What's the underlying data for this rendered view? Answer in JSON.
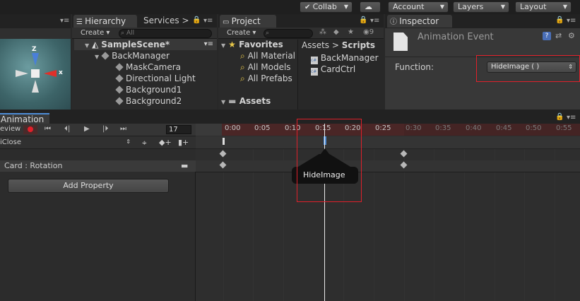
{
  "toolbar": {
    "collab": "Collab",
    "account": "Account",
    "layers": "Layers",
    "layout": "Layout"
  },
  "hierarchy": {
    "tab": "Hierarchy",
    "tab2": "Services",
    "create": "Create",
    "search_placeholder": "All",
    "scene": "SampleScene*",
    "root": "BackManager",
    "items": [
      "MaskCamera",
      "Directional Light",
      "Background1",
      "Background2"
    ]
  },
  "project": {
    "tab": "Project",
    "create": "Create",
    "count": "9",
    "favorites": "Favorites",
    "fav_items": [
      "All Material",
      "All Models",
      "All Prefabs"
    ],
    "assets": "Assets",
    "breadcrumb_root": "Assets",
    "breadcrumb_current": "Scripts",
    "files": [
      "BackManager",
      "CardCtrl"
    ]
  },
  "inspector": {
    "tab": "Inspector",
    "title": "Animation Event",
    "function_label": "Function:",
    "function_value": "HideImage ( )"
  },
  "animation": {
    "tab": "Animation",
    "preview": "eview",
    "frame": "17",
    "clip": "iClose",
    "property": "Card : Rotation",
    "add_property": "Add Property",
    "tooltip": "HideImage",
    "ticks": [
      "0:00",
      "0:05",
      "0:10",
      "0:15",
      "0:20",
      "0:25",
      "0:30",
      "0:35",
      "0:40",
      "0:45",
      "0:50",
      "0:55"
    ]
  },
  "colors": {
    "accent_red": "#e0202a",
    "keyframe": "#b8b8b8",
    "event_marker": "#4e8cd6"
  }
}
